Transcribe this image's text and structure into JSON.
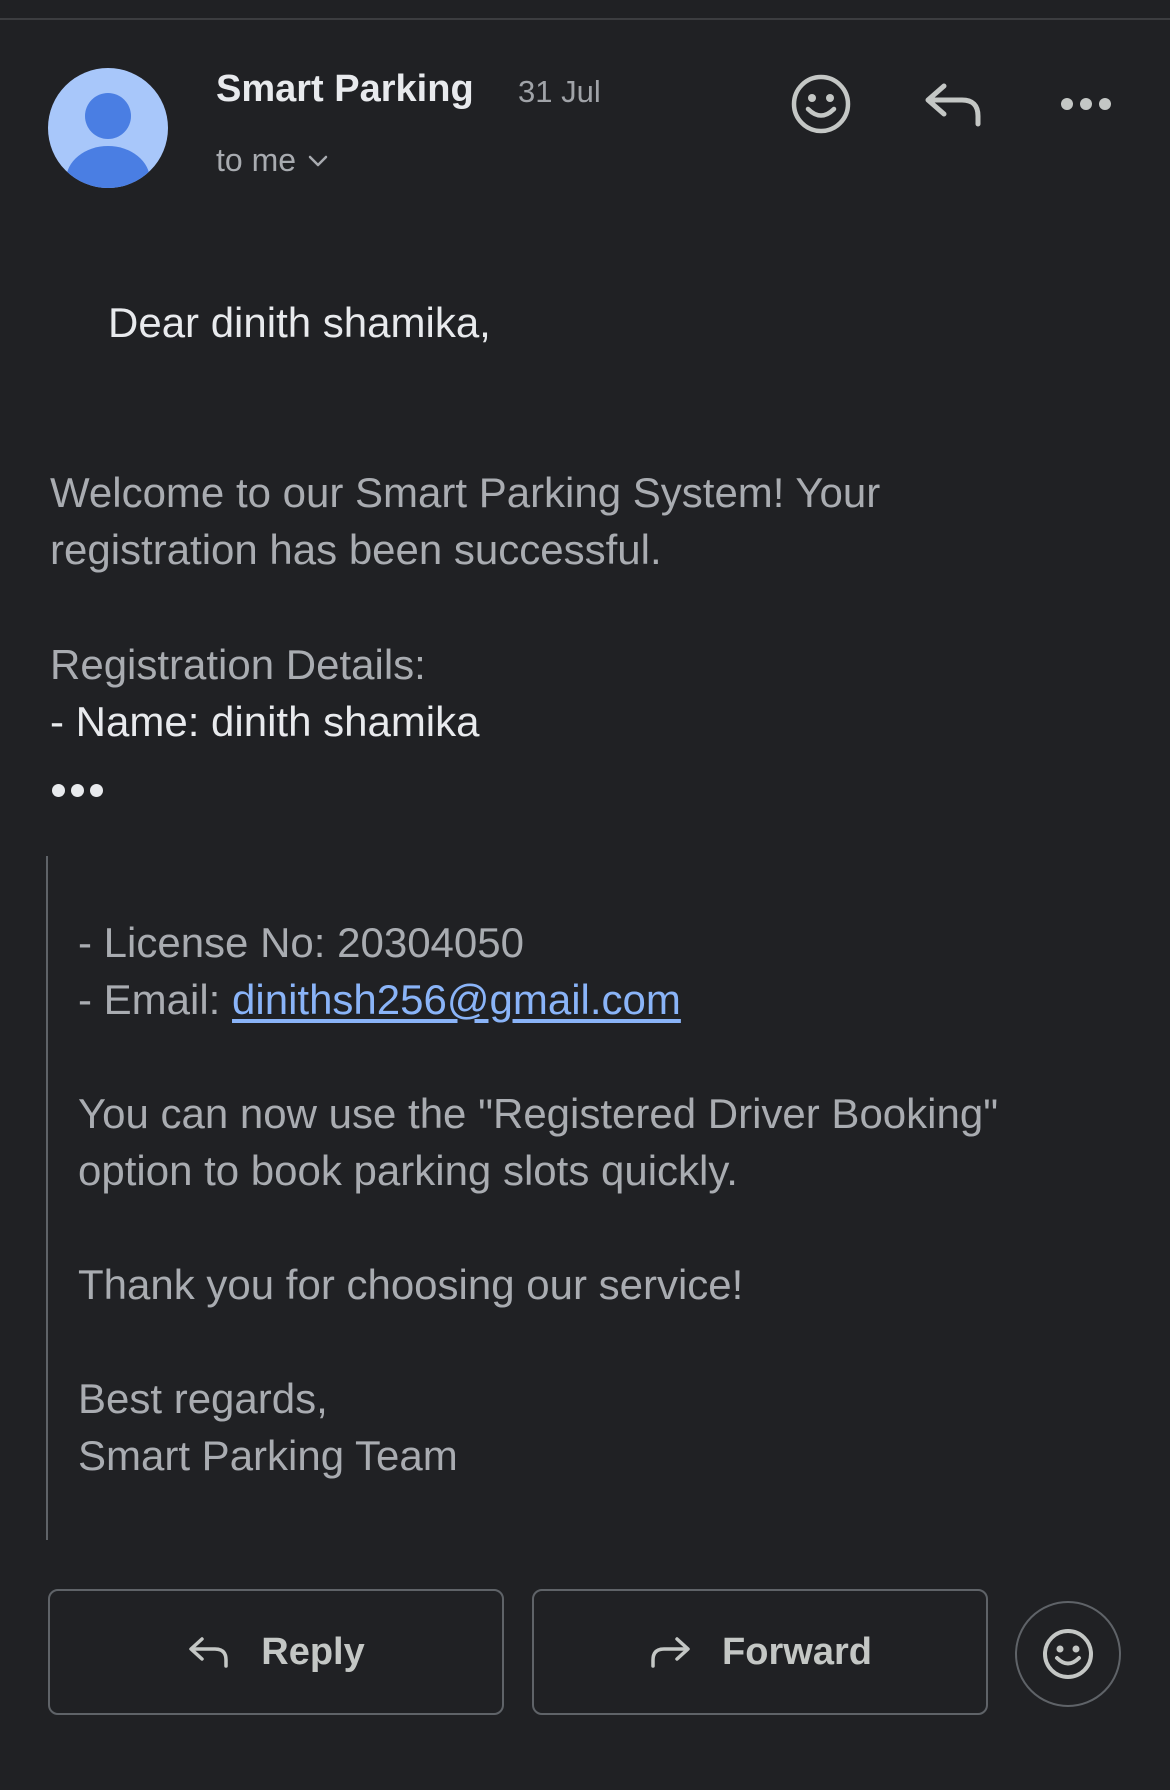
{
  "header": {
    "sender": "Smart Parking",
    "date": "31 Jul",
    "recipient": "to me",
    "icons": [
      "avatar-person-icon",
      "add-reaction-icon",
      "reply-icon",
      "more-options-icon",
      "chevron-down-icon"
    ]
  },
  "message": {
    "greeting": "Dear dinith shamika,",
    "welcome_line1": "Welcome to our Smart Parking System! Your",
    "welcome_line2": "registration has been successful.",
    "details_heading": "Registration Details:",
    "name_line": "- Name: dinith shamika"
  },
  "quoted": {
    "license_line": "- License No: 20304050",
    "email_prefix": "- Email: ",
    "email": "dinithsh256@gmail.com",
    "usage_line1": "You can now use the \"Registered Driver Booking\"",
    "usage_line2": "option to book parking slots quickly.",
    "thanks_line": "Thank you for choosing our service!",
    "regards_line": "Best regards,",
    "team_line": "Smart Parking Team"
  },
  "actions": {
    "reply_label": "Reply",
    "forward_label": "Forward"
  },
  "colors": {
    "background": "#202124",
    "link": "#8ab4f8",
    "avatar_bg": "#a8c7fa",
    "avatar_fg": "#4a7ee3"
  }
}
